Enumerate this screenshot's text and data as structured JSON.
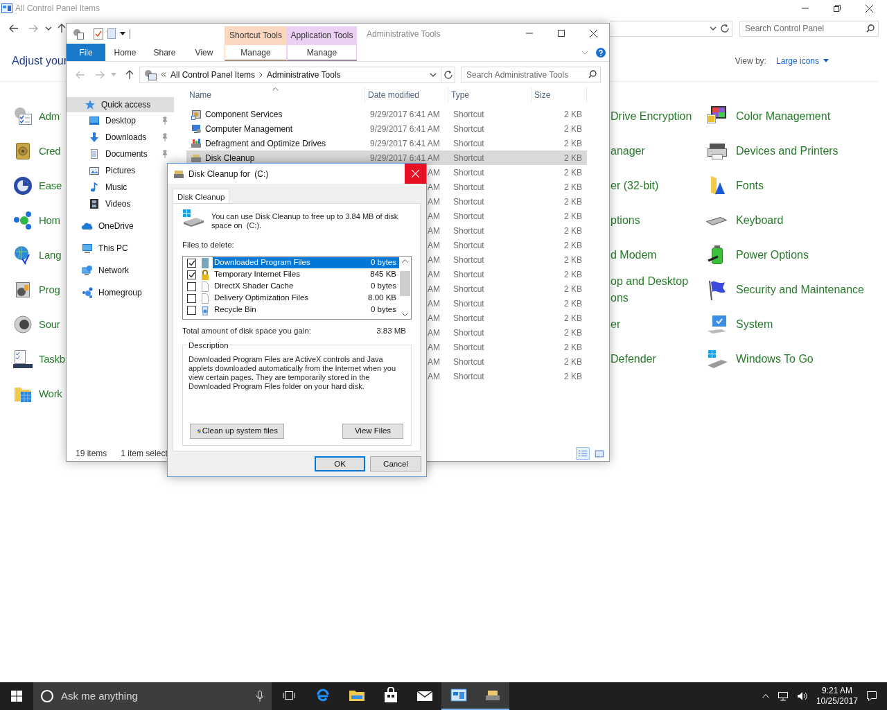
{
  "control_panel": {
    "title": "All Control Panel Items",
    "search": {
      "placeholder": "Search Control Panel"
    },
    "heading": "Adjust your",
    "view_by_label": "View by:",
    "view_by_value": "Large icons",
    "column_1": [
      "Adm",
      "Cred",
      "Ease",
      "Hom",
      "Lang",
      "Prog",
      "Sour",
      "Taskb",
      "Work"
    ],
    "column_2": [
      "Drive Encryption",
      "anager",
      "er (32-bit)",
      "ptions",
      "d Modem",
      "op and Desktop ons",
      "er",
      "Defender"
    ],
    "column_3": [
      "Color Management",
      "Devices and Printers",
      "Fonts",
      "Keyboard",
      "Power Options",
      "Security and Maintenance",
      "System",
      "Windows To Go"
    ]
  },
  "explorer": {
    "title": "Administrative Tools",
    "ribbon": {
      "file_tab": "File",
      "tabs": [
        "Home",
        "Share",
        "View"
      ],
      "contextual": [
        {
          "header": "Shortcut Tools",
          "color": "#fbd7c0",
          "tab": "Manage"
        },
        {
          "header": "Application Tools",
          "color": "#ecd0f4",
          "tab": "Manage"
        }
      ]
    },
    "address": [
      "All Control Panel Items",
      "Administrative Tools"
    ],
    "search": {
      "placeholder": "Search Administrative Tools"
    },
    "nav_pane": [
      {
        "label": "Quick access",
        "selected": true,
        "children": [
          {
            "label": "Desktop",
            "pinned": true,
            "selected": false
          },
          {
            "label": "Downloads",
            "pinned": true,
            "selected": false
          },
          {
            "label": "Documents",
            "pinned": true,
            "selected": false
          },
          {
            "label": "Pictures",
            "pinned": false,
            "selected": false
          },
          {
            "label": "Music",
            "pinned": false,
            "selected": false
          },
          {
            "label": "Videos",
            "pinned": false,
            "selected": false
          }
        ]
      },
      {
        "label": "OneDrive",
        "selected": false
      },
      {
        "label": "This PC",
        "selected": false
      },
      {
        "label": "Network",
        "selected": false
      },
      {
        "label": "Homegroup",
        "selected": false
      }
    ],
    "columns": [
      {
        "label": "Name",
        "sorted": true
      },
      {
        "label": "Date modified",
        "sorted": false
      },
      {
        "label": "Type",
        "sorted": false
      },
      {
        "label": "Size",
        "sorted": false
      }
    ],
    "rows": [
      {
        "name": "Component Services",
        "date": "9/29/2017 6:41 AM",
        "type": "Shortcut",
        "size": "2 KB",
        "selected": false
      },
      {
        "name": "Computer Management",
        "date": "9/29/2017 6:41 AM",
        "type": "Shortcut",
        "size": "2 KB",
        "selected": false
      },
      {
        "name": "Defragment and Optimize Drives",
        "date": "9/29/2017 6:41 AM",
        "type": "Shortcut",
        "size": "2 KB",
        "selected": false
      },
      {
        "name": "Disk Cleanup",
        "date": "9/29/2017 6:41 AM",
        "type": "Shortcut",
        "size": "2 KB",
        "selected": true
      },
      {
        "date": "AM",
        "type": "Shortcut",
        "size": "2 KB",
        "selected": false
      },
      {
        "date": "AM",
        "type": "Shortcut",
        "size": "2 KB",
        "selected": false
      },
      {
        "date": "AM",
        "type": "Shortcut",
        "size": "2 KB",
        "selected": false
      },
      {
        "date": "AM",
        "type": "Shortcut",
        "size": "2 KB",
        "selected": false
      },
      {
        "date": "AM",
        "type": "Shortcut",
        "size": "2 KB",
        "selected": false
      },
      {
        "date": "AM",
        "type": "Shortcut",
        "size": "2 KB",
        "selected": false
      },
      {
        "date": "AM",
        "type": "Shortcut",
        "size": "2 KB",
        "selected": false
      },
      {
        "date": "AM",
        "type": "Shortcut",
        "size": "2 KB",
        "selected": false
      },
      {
        "date": "AM",
        "type": "Shortcut",
        "size": "2 KB",
        "selected": false
      },
      {
        "date": "AM",
        "type": "Shortcut",
        "size": "2 KB",
        "selected": false
      },
      {
        "date": "AM",
        "type": "Shortcut",
        "size": "2 KB",
        "selected": false
      },
      {
        "date": "AM",
        "type": "Shortcut",
        "size": "2 KB",
        "selected": false
      },
      {
        "date": "AM",
        "type": "Shortcut",
        "size": "2 KB",
        "selected": false
      },
      {
        "date": "AM",
        "type": "Shortcut",
        "size": "2 KB",
        "selected": false
      },
      {
        "date": "AM",
        "type": "Shortcut",
        "size": "2 KB",
        "selected": false
      }
    ],
    "status": {
      "items": "19 items",
      "selection": "1 item select"
    },
    "view_modes": [
      {
        "selected": true
      },
      {
        "selected": false
      }
    ]
  },
  "dialog": {
    "title": "Disk Cleanup for  (C:)",
    "tab": "Disk Cleanup",
    "intro": "You can use Disk Cleanup to free up to 3.84 MB of disk space on  (C:).",
    "files_label": "Files to delete:",
    "files": [
      {
        "name": "Downloaded Program Files",
        "size": "0 bytes",
        "checked": true,
        "selected": true
      },
      {
        "name": "Temporary Internet Files",
        "size": "845 KB",
        "checked": true,
        "selected": false
      },
      {
        "name": "DirectX Shader Cache",
        "size": "0 bytes",
        "checked": false,
        "selected": false
      },
      {
        "name": "Delivery Optimization Files",
        "size": "8.00 KB",
        "checked": false,
        "selected": false
      },
      {
        "name": "Recycle Bin",
        "size": "0 bytes",
        "checked": false,
        "selected": false
      }
    ],
    "total_label": "Total amount of disk space you gain:",
    "total": "3.83 MB",
    "description_label": "Description",
    "description": "Downloaded Program Files are ActiveX controls and Java applets downloaded automatically from the Internet when you view certain pages. They are temporarily stored in the Downloaded Program Files folder on your hard disk.",
    "cleanup_button": "Clean up system files",
    "view_button": "View Files",
    "ok": "OK",
    "cancel": "Cancel"
  },
  "taskbar": {
    "search": {
      "placeholder": "Ask me anything"
    },
    "apps": [
      {
        "active": false
      },
      {
        "active": false
      },
      {
        "active": false
      },
      {
        "active": false
      },
      {
        "active": true
      },
      {
        "active": true
      }
    ],
    "clock": {
      "time": "9:21 AM",
      "date": "10/25/2017"
    }
  }
}
